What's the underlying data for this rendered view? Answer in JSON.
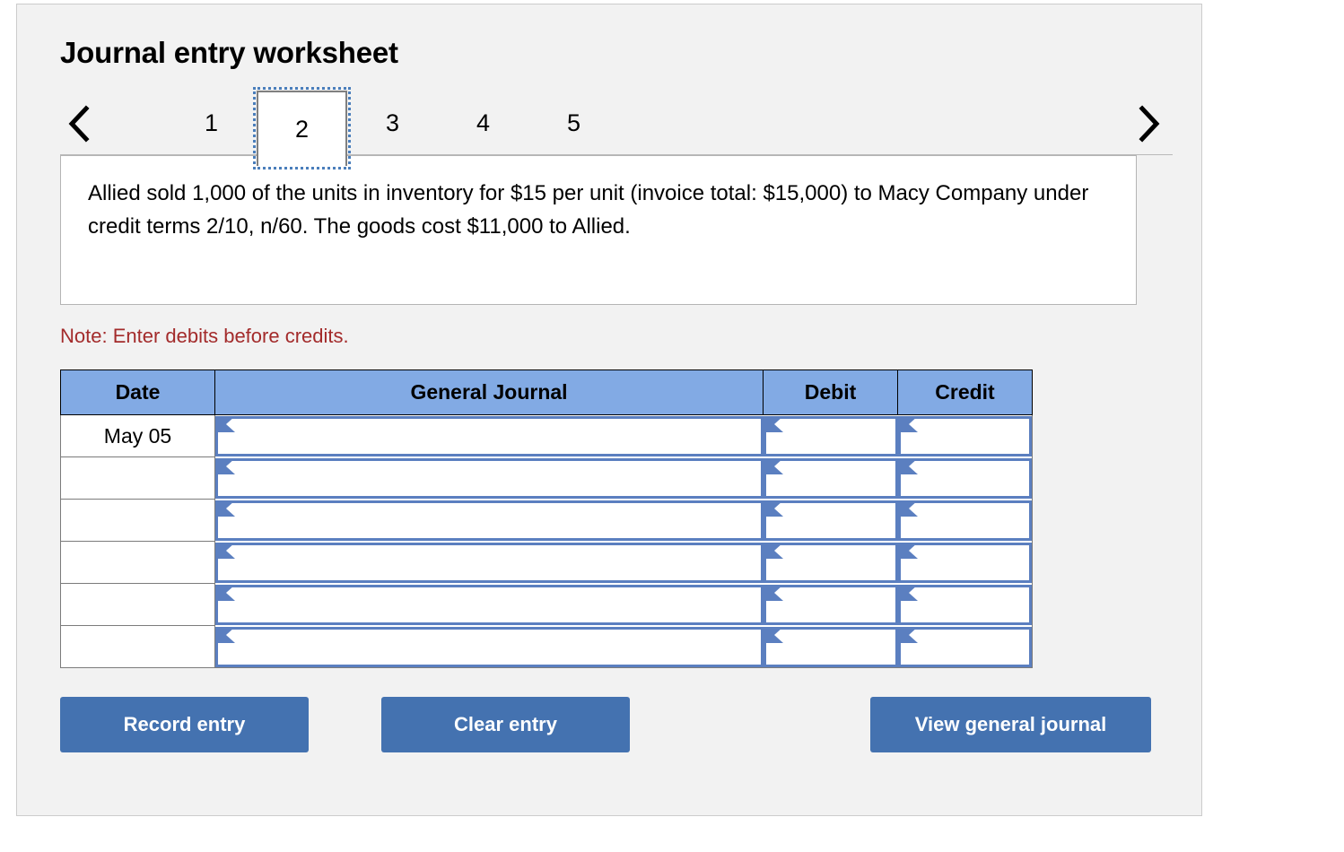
{
  "worksheet": {
    "title": "Journal entry worksheet",
    "note": "Note: Enter debits before credits.",
    "description": "Allied sold 1,000 of the units in inventory for $15 per unit (invoice total: $15,000) to Macy Company under credit terms 2/10, n/60. The goods cost $11,000 to Allied."
  },
  "navigation": {
    "prev_icon": "chevron-left-icon",
    "next_icon": "chevron-right-icon",
    "tabs": [
      {
        "label": "1",
        "active": false
      },
      {
        "label": "2",
        "active": true
      },
      {
        "label": "3",
        "active": false
      },
      {
        "label": "4",
        "active": false
      },
      {
        "label": "5",
        "active": false
      }
    ]
  },
  "table": {
    "columns": [
      "Date",
      "General Journal",
      "Debit",
      "Credit"
    ],
    "rows": [
      {
        "date": "May 05",
        "journal": "",
        "debit": "",
        "credit": ""
      },
      {
        "date": "",
        "journal": "",
        "debit": "",
        "credit": ""
      },
      {
        "date": "",
        "journal": "",
        "debit": "",
        "credit": ""
      },
      {
        "date": "",
        "journal": "",
        "debit": "",
        "credit": ""
      },
      {
        "date": "",
        "journal": "",
        "debit": "",
        "credit": ""
      },
      {
        "date": "",
        "journal": "",
        "debit": "",
        "credit": ""
      }
    ]
  },
  "buttons": {
    "record": "Record entry",
    "clear": "Clear entry",
    "view": "View general journal"
  },
  "colors": {
    "panel_bg": "#f2f2f2",
    "header_blue": "#82aae4",
    "field_blue": "#5b7fc0",
    "button_blue": "#4472b0",
    "note_red": "#a32b2b"
  }
}
